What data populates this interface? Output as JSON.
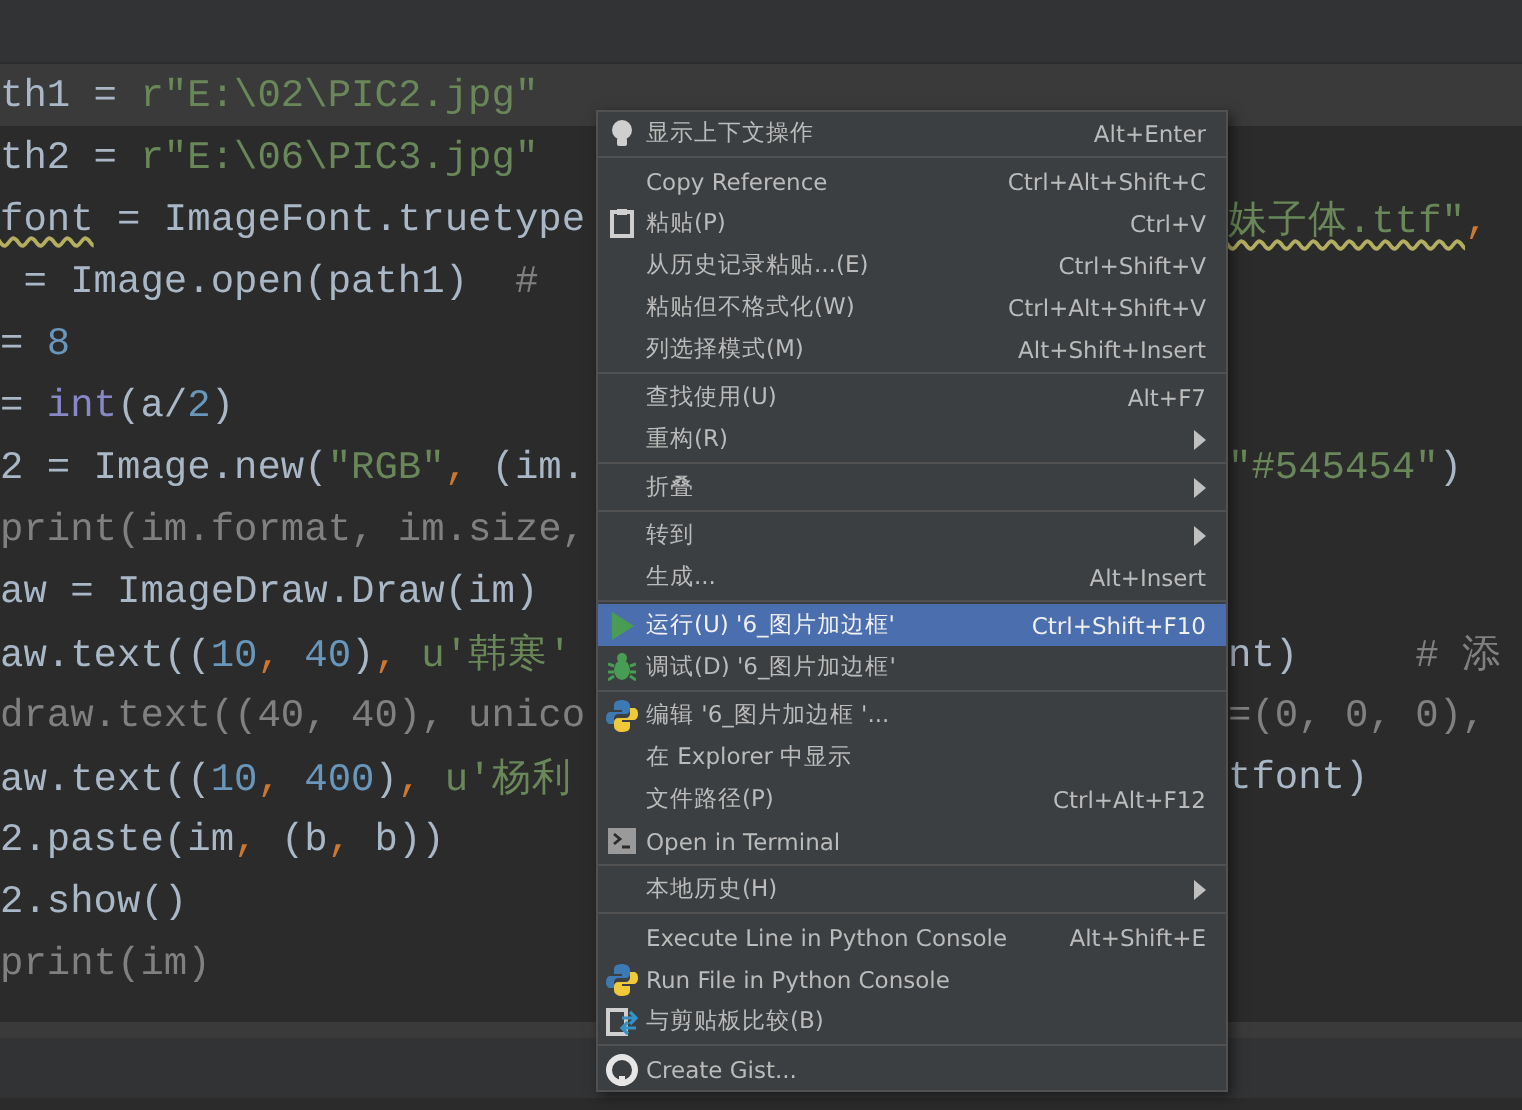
{
  "editor": {
    "lines": [
      {
        "current": true,
        "left": [
          {
            "kind": "plain",
            "text": "th1 = "
          },
          {
            "kind": "string",
            "text": "r\"E:\\02\\PIC2.jpg\""
          }
        ]
      },
      {
        "current": false,
        "left": [
          {
            "kind": "plain",
            "text": "th2 = "
          },
          {
            "kind": "string",
            "text": "r\"E:\\06\\PIC3.jpg\""
          }
        ]
      },
      {
        "current": false,
        "left": [
          {
            "kind": "plain",
            "text": "font",
            "warning": true
          },
          {
            "kind": "plain",
            "text": " = ImageFont.truetype"
          }
        ],
        "right": [
          {
            "kind": "string",
            "text": "妹子体.ttf\"",
            "warning": true
          },
          {
            "kind": "comma",
            "text": ","
          }
        ]
      },
      {
        "current": false,
        "left": [
          {
            "kind": "plain",
            "text": " = Image.open(path1)  "
          },
          {
            "kind": "comment",
            "text": "# "
          }
        ]
      },
      {
        "current": false,
        "left": [
          {
            "kind": "plain",
            "text": "= "
          },
          {
            "kind": "number",
            "text": "8"
          }
        ]
      },
      {
        "current": false,
        "left": [
          {
            "kind": "plain",
            "text": "= "
          },
          {
            "kind": "builtin",
            "text": "int"
          },
          {
            "kind": "plain",
            "text": "(a/"
          },
          {
            "kind": "number",
            "text": "2"
          },
          {
            "kind": "plain",
            "text": ")"
          }
        ]
      },
      {
        "current": false,
        "left": [
          {
            "kind": "plain",
            "text": "2 = Image.new("
          },
          {
            "kind": "string",
            "text": "\"RGB\""
          },
          {
            "kind": "comma",
            "text": ", "
          },
          {
            "kind": "plain",
            "text": "(im."
          }
        ],
        "right": [
          {
            "kind": "string",
            "text": "\"#545454\""
          },
          {
            "kind": "plain",
            "text": ")"
          }
        ]
      },
      {
        "current": false,
        "left": [
          {
            "kind": "comment",
            "text": "print(im.format, im.size,"
          }
        ]
      },
      {
        "current": false,
        "left": [
          {
            "kind": "plain",
            "text": "aw = ImageDraw.Draw(im)"
          }
        ]
      },
      {
        "current": false,
        "left": [
          {
            "kind": "plain",
            "text": "aw.text(("
          },
          {
            "kind": "number",
            "text": "10"
          },
          {
            "kind": "comma",
            "text": ", "
          },
          {
            "kind": "number",
            "text": "40"
          },
          {
            "kind": "plain",
            "text": ")"
          },
          {
            "kind": "comma",
            "text": ", "
          },
          {
            "kind": "string",
            "text": "u'韩寒'"
          }
        ],
        "right": [
          {
            "kind": "plain",
            "text": "nt)     "
          },
          {
            "kind": "comment",
            "text": "# 添"
          }
        ]
      },
      {
        "current": false,
        "left": [
          {
            "kind": "comment",
            "text": "draw.text((40, 40), unico"
          }
        ],
        "right": [
          {
            "kind": "comment",
            "text": "=(0, 0, 0),"
          }
        ]
      },
      {
        "current": false,
        "left": [
          {
            "kind": "plain",
            "text": "aw.text(("
          },
          {
            "kind": "number",
            "text": "10"
          },
          {
            "kind": "comma",
            "text": ", "
          },
          {
            "kind": "number",
            "text": "400"
          },
          {
            "kind": "plain",
            "text": ")"
          },
          {
            "kind": "comma",
            "text": ", "
          },
          {
            "kind": "string",
            "text": "u'杨利"
          }
        ],
        "right": [
          {
            "kind": "plain",
            "text": "tfont)"
          }
        ]
      },
      {
        "current": false,
        "left": [
          {
            "kind": "plain",
            "text": "2.paste(im"
          },
          {
            "kind": "comma",
            "text": ", "
          },
          {
            "kind": "plain",
            "text": "(b"
          },
          {
            "kind": "comma",
            "text": ", "
          },
          {
            "kind": "plain",
            "text": "b))"
          }
        ]
      },
      {
        "current": false,
        "left": [
          {
            "kind": "plain",
            "text": "2.show()"
          }
        ]
      },
      {
        "current": false,
        "left": [
          {
            "kind": "comment",
            "text": "print(im)"
          }
        ]
      }
    ]
  },
  "context_menu": {
    "groups": [
      {
        "items": [
          {
            "label": "显示上下文操作",
            "shortcut": "Alt+Enter",
            "submenu": false,
            "selected": false
          }
        ]
      },
      {
        "items": [
          {
            "label": "Copy Reference",
            "shortcut": "Ctrl+Alt+Shift+C",
            "submenu": false,
            "selected": false
          },
          {
            "label": "粘贴(P)",
            "shortcut": "Ctrl+V",
            "submenu": false,
            "selected": false
          },
          {
            "label": "从历史记录粘贴...(E)",
            "shortcut": "Ctrl+Shift+V",
            "submenu": false,
            "selected": false
          },
          {
            "label": "粘贴但不格式化(W)",
            "shortcut": "Ctrl+Alt+Shift+V",
            "submenu": false,
            "selected": false
          },
          {
            "label": "列选择模式(M)",
            "shortcut": "Alt+Shift+Insert",
            "submenu": false,
            "selected": false
          }
        ]
      },
      {
        "items": [
          {
            "label": "查找使用(U)",
            "shortcut": "Alt+F7",
            "submenu": false,
            "selected": false
          },
          {
            "label": "重构(R)",
            "submenu": true,
            "selected": false
          }
        ]
      },
      {
        "items": [
          {
            "label": "折叠",
            "submenu": true,
            "selected": false
          }
        ]
      },
      {
        "items": [
          {
            "label": "转到",
            "submenu": true,
            "selected": false
          },
          {
            "label": "生成...",
            "shortcut": "Alt+Insert",
            "submenu": false,
            "selected": false
          }
        ]
      },
      {
        "items": [
          {
            "label": "运行(U) '6_图片加边框'",
            "shortcut": "Ctrl+Shift+F10",
            "submenu": false,
            "selected": true
          },
          {
            "label": "调试(D) '6_图片加边框'",
            "submenu": false,
            "selected": false
          }
        ]
      },
      {
        "items": [
          {
            "label": "编辑 '6_图片加边框 '...",
            "submenu": false,
            "selected": false
          },
          {
            "label": "在 Explorer 中显示",
            "submenu": false,
            "selected": false
          },
          {
            "label": "文件路径(P)",
            "shortcut": "Ctrl+Alt+F12",
            "submenu": false,
            "selected": false
          },
          {
            "label": "Open in Terminal",
            "submenu": false,
            "selected": false
          }
        ]
      },
      {
        "items": [
          {
            "label": "本地历史(H)",
            "submenu": true,
            "selected": false
          }
        ]
      },
      {
        "items": [
          {
            "label": "Execute Line in Python Console",
            "shortcut": "Alt+Shift+E",
            "submenu": false,
            "selected": false
          },
          {
            "label": "Run File in Python Console",
            "submenu": false,
            "selected": false
          },
          {
            "label": "与剪贴板比较(B)",
            "submenu": false,
            "selected": false
          }
        ]
      },
      {
        "items": [
          {
            "label": "Create Gist...",
            "submenu": false,
            "selected": false
          }
        ]
      }
    ]
  }
}
